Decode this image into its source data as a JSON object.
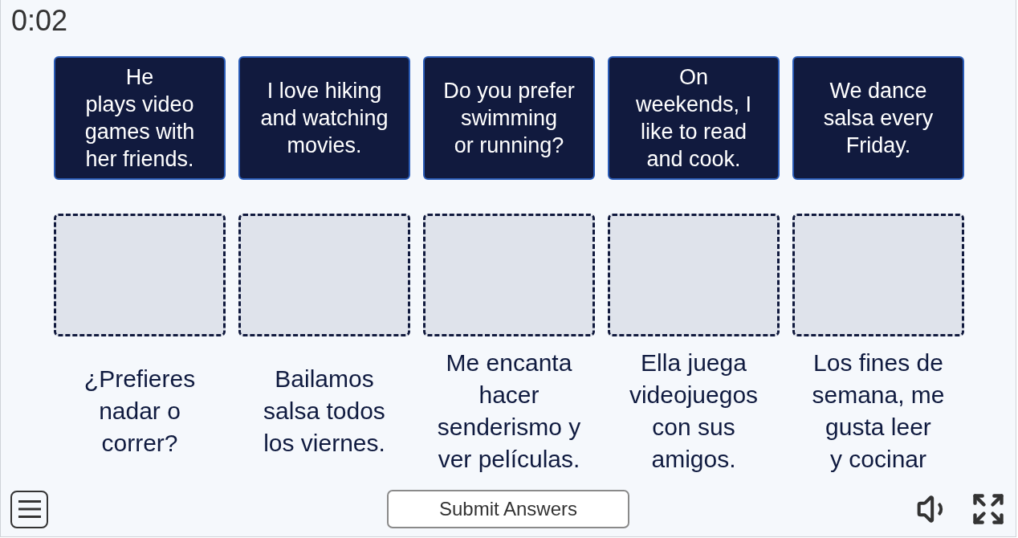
{
  "timer": "0:02",
  "cards": [
    "He\nplays video\ngames with\nher friends.",
    "I love hiking\nand watching\nmovies.",
    "Do you prefer\nswimming\nor running?",
    "On\nweekends, I\nlike to read\nand cook.",
    "We dance\nsalsa every\nFriday."
  ],
  "drop_zones": [
    {
      "filled": false
    },
    {
      "filled": false
    },
    {
      "filled": false
    },
    {
      "filled": false
    },
    {
      "filled": false
    }
  ],
  "answers": [
    "¿Prefieres\nnadar o\ncorrer?",
    "Bailamos\nsalsa todos\nlos viernes.",
    "Me encanta\nhacer\nsenderismo y\nver películas.",
    "Ella juega\nvideojuegos\ncon sus\namigos.",
    "Los fines de\nsemana, me\ngusta leer\ny cocinar"
  ],
  "footer": {
    "submit_button": "Submit Answers"
  }
}
